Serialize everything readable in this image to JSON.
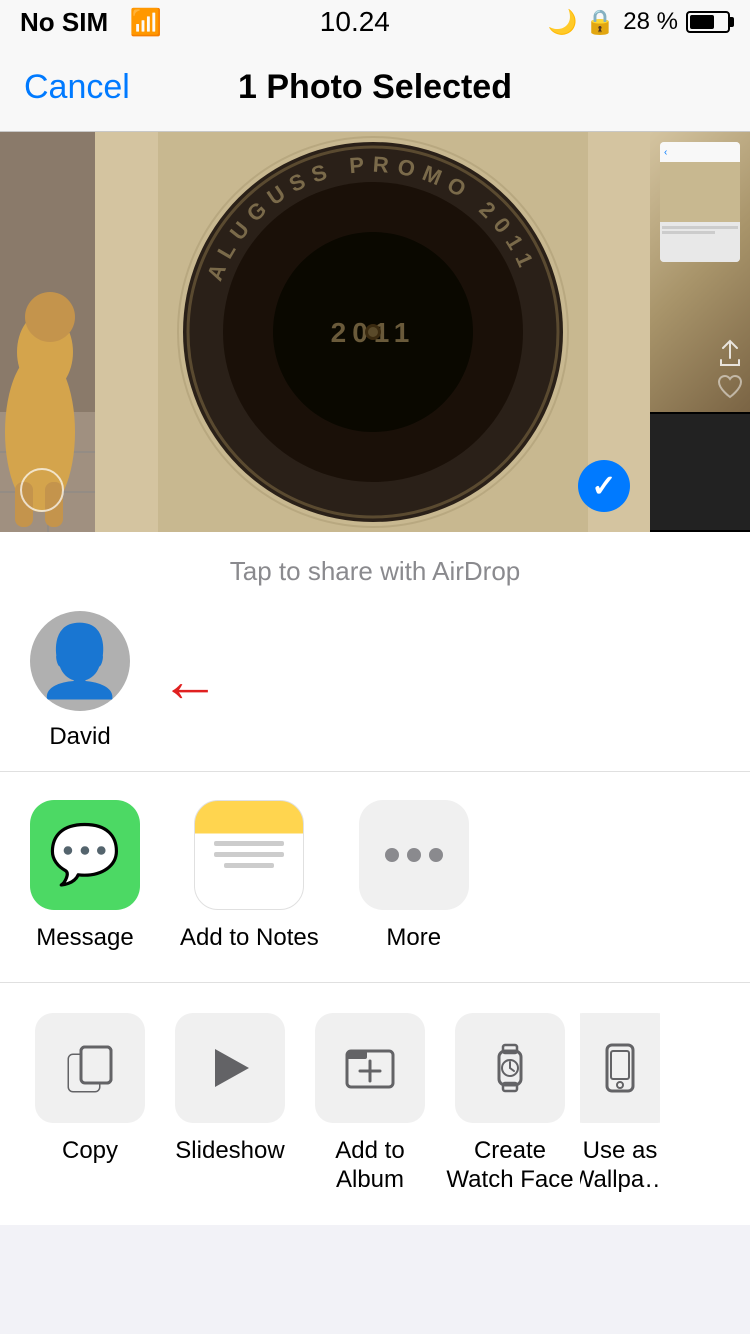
{
  "statusBar": {
    "carrier": "No SIM",
    "time": "10.24",
    "battery": "28 %"
  },
  "navBar": {
    "cancelLabel": "Cancel",
    "title": "1 Photo Selected"
  },
  "airdrop": {
    "tapLabel": "Tap to share with AirDrop",
    "contacts": [
      {
        "name": "David"
      }
    ]
  },
  "appShare": {
    "items": [
      {
        "id": "message",
        "label": "Message"
      },
      {
        "id": "notes",
        "label": "Add to Notes"
      },
      {
        "id": "more",
        "label": "More"
      }
    ]
  },
  "actions": {
    "items": [
      {
        "id": "copy",
        "label": "Copy"
      },
      {
        "id": "slideshow",
        "label": "Slideshow"
      },
      {
        "id": "add-album",
        "label": "Add to Album"
      },
      {
        "id": "watch-face",
        "label": "Create Watch Face"
      },
      {
        "id": "wallpaper",
        "label": "Use as Wallpa…"
      }
    ]
  }
}
